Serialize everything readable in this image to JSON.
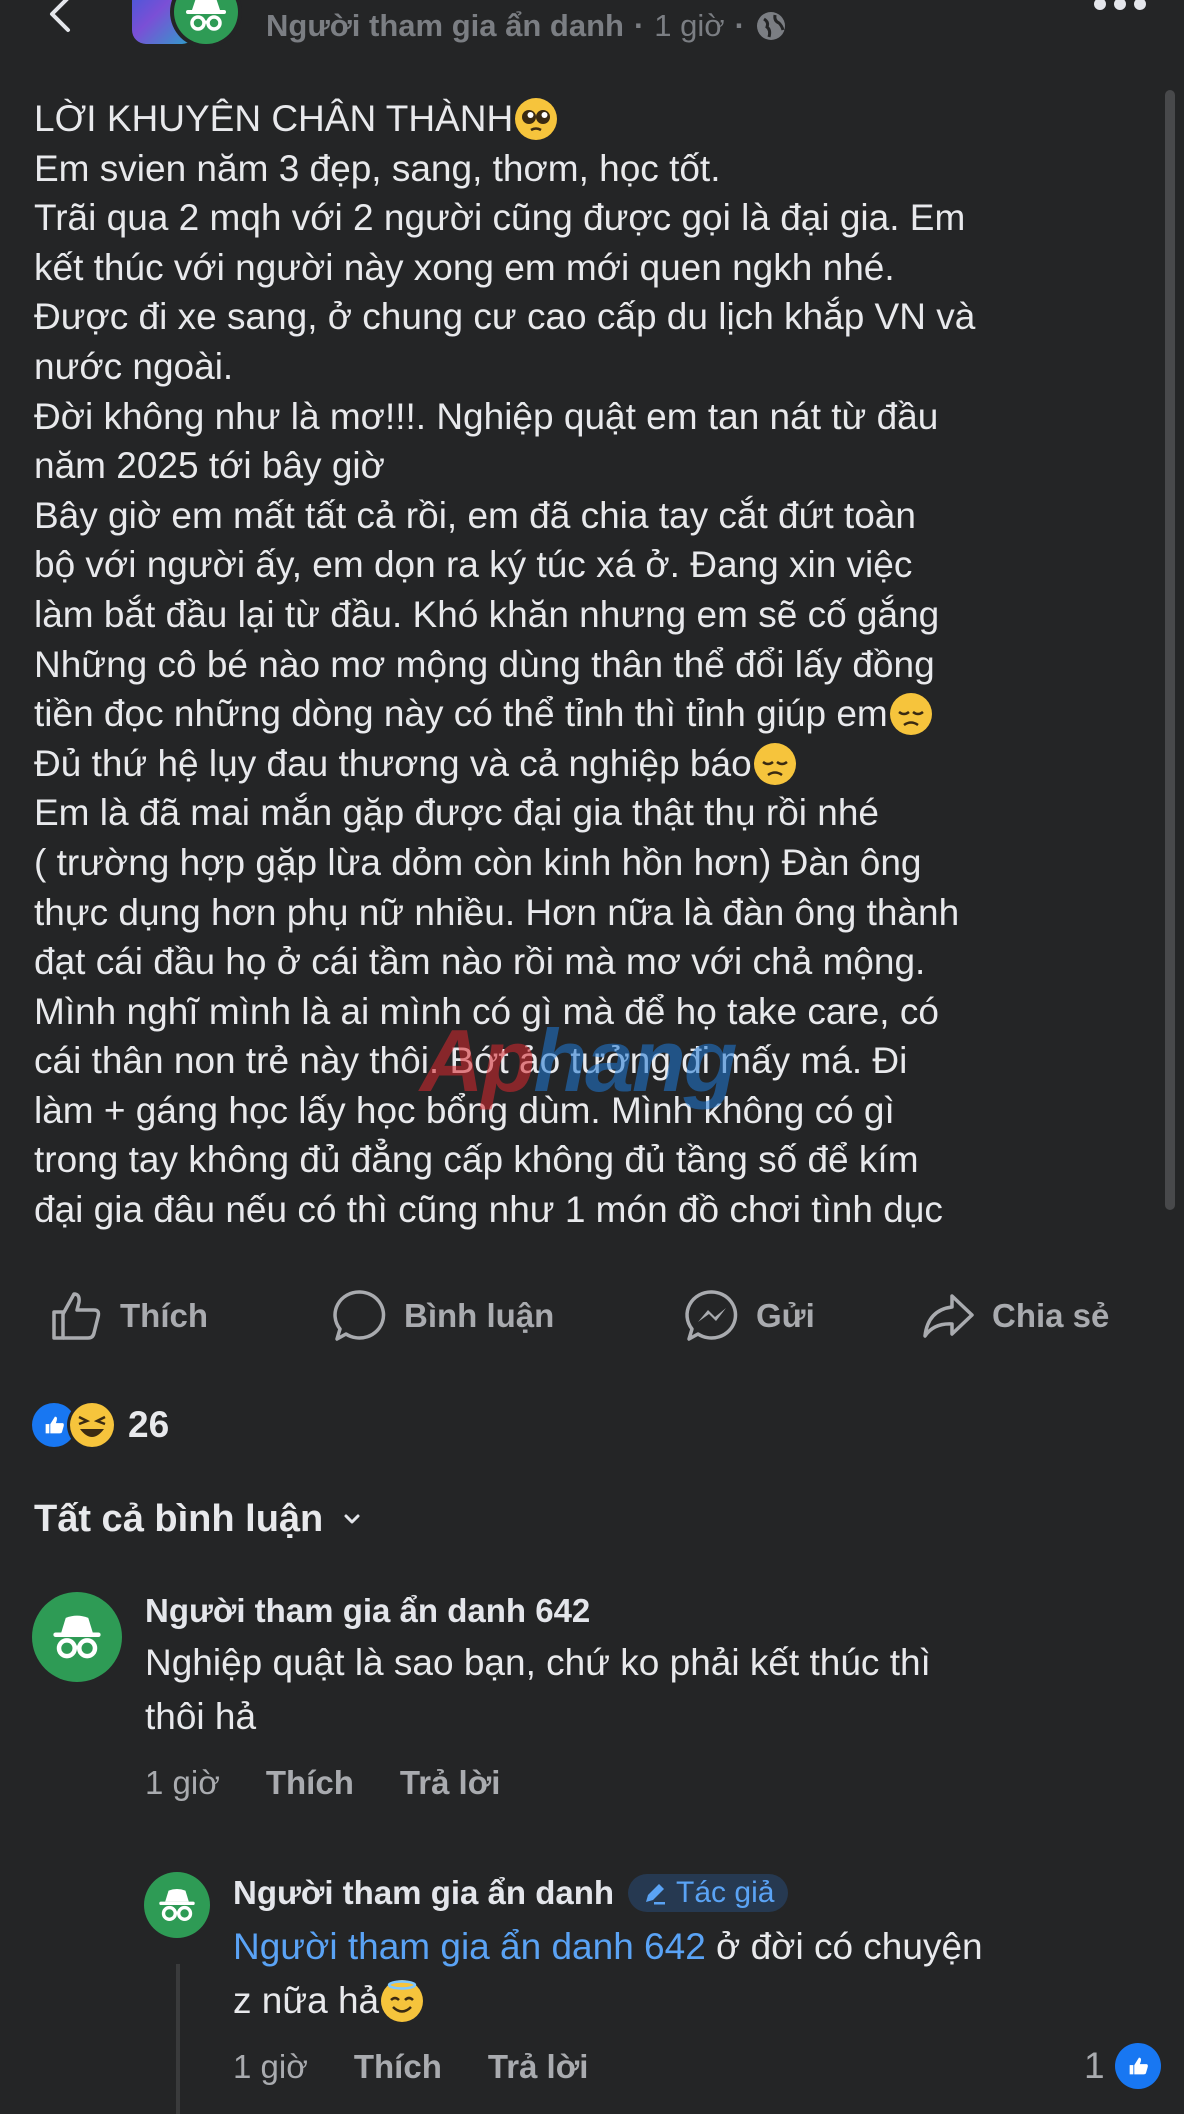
{
  "header": {
    "author": "Người tham gia ẩn danh",
    "separator": "·",
    "time": "1 giờ",
    "privacy_icon": "globe-icon",
    "more_icon": "more-icon"
  },
  "post": {
    "lines": [
      "LỜI KHUYÊN CHÂN THÀNH",
      "Em svien năm 3 đẹp, sang, thơm, học tốt.",
      "Trãi qua 2 mqh với 2 người cũng được gọi là đại gia. Em",
      "kết thúc với người này xong em mới quen ngkh nhé.",
      "Được đi xe sang, ở chung cư cao cấp du lịch khắp VN và",
      "nước ngoài.",
      "Đời không như là mơ!!!. Nghiệp quật em tan nát từ đầu",
      "năm 2025 tới bây giờ",
      "Bây giờ em mất tất cả rồi, em đã chia tay cắt đứt toàn",
      "bộ với người ấy, em dọn ra ký túc xá ở. Đang xin việc",
      "làm bắt đầu lại từ đầu. Khó khăn nhưng em sẽ cố gắng",
      "Những cô bé nào mơ mộng dùng thân thể đổi lấy đồng",
      "tiền đọc những dòng này có thể tỉnh thì tỉnh giúp em",
      "Đủ thứ hệ lụy đau thương và cả nghiệp báo",
      "Em là đã mai mắn gặp được đại gia thật thụ rồi nhé",
      "( trường hợp gặp lừa dỏm còn kinh hồn hơn) Đàn ông",
      "thực dụng hơn phụ nữ nhiều. Hơn nữa là đàn ông thành",
      "đạt cái đầu họ ở cái tầm nào rồi mà mơ với chả mộng.",
      "Mình nghĩ mình là ai mình có gì mà để họ take care, có",
      "cái thân non trẻ này thôi. Bớt ảo tưởng đi mấy má. Đi",
      "làm + gáng học lấy học bổng dùm. Mình không có gì",
      "trong tay không đủ đẳng cấp không đủ tầng số để kím",
      "đại gia đâu nếu có thì cũng như 1 món đồ chơi tình dục"
    ],
    "emojis": {
      "line_0": "pleading-face-emoji",
      "line_12": "disappointed-face-emoji",
      "line_13": "disappointed-face-emoji"
    }
  },
  "actions": {
    "like": "Thích",
    "comment": "Bình luận",
    "send": "Gửi",
    "share": "Chia sẻ"
  },
  "reactions": {
    "count": "26",
    "types": [
      "like",
      "haha"
    ]
  },
  "comments_filter": {
    "label": "Tất cả bình luận"
  },
  "watermark": {
    "part_red": "Ap",
    "part_blue": "hang"
  },
  "comments": [
    {
      "name": "Người tham gia ẩn danh 642",
      "text_line1": "Nghiệp quật là sao bạn, chứ ko phải kết thúc thì",
      "text_line2": "thôi hả",
      "time": "1 giờ",
      "like": "Thích",
      "reply": "Trả lời"
    },
    {
      "name": "Người tham gia ẩn danh",
      "badge": "Tác giả",
      "mention": "Người tham gia ẩn danh 642",
      "text_after_mention": " ở đời có chuyện",
      "text_line2": "z nữa hả",
      "time": "1 giờ",
      "like": "Thích",
      "reply": "Trả lời",
      "like_count": "1"
    }
  ],
  "colors": {
    "background": "#242526",
    "text": "#e8e9ec",
    "muted": "#a9abaf",
    "accent": "#1877f2",
    "anon_green": "#2e9b55",
    "badge_bg": "#263951",
    "link": "#5aa3f5"
  }
}
